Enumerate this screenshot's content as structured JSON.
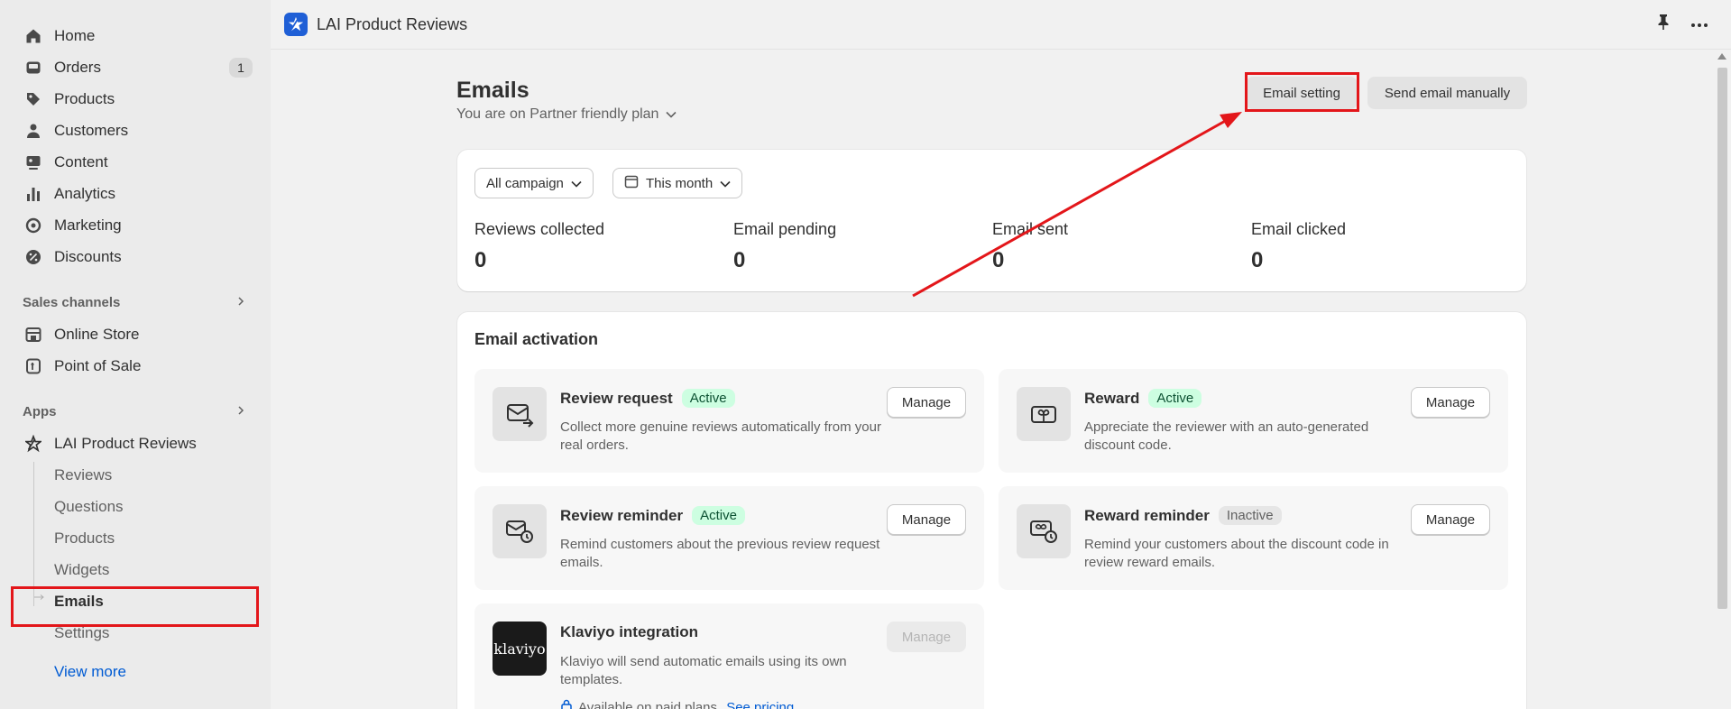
{
  "sidebar": {
    "nav": [
      {
        "label": "Home",
        "icon": "home-icon"
      },
      {
        "label": "Orders",
        "icon": "inbox-icon",
        "badge": "1"
      },
      {
        "label": "Products",
        "icon": "tag-icon"
      },
      {
        "label": "Customers",
        "icon": "person-icon"
      },
      {
        "label": "Content",
        "icon": "content-icon"
      },
      {
        "label": "Analytics",
        "icon": "bar-chart-icon"
      },
      {
        "label": "Marketing",
        "icon": "target-icon"
      },
      {
        "label": "Discounts",
        "icon": "discount-icon"
      }
    ],
    "sales_channels": {
      "title": "Sales channels",
      "items": [
        {
          "label": "Online Store"
        },
        {
          "label": "Point of Sale"
        }
      ]
    },
    "apps": {
      "title": "Apps",
      "app_name": "LAI Product Reviews",
      "sub_items": [
        {
          "label": "Reviews"
        },
        {
          "label": "Questions"
        },
        {
          "label": "Products"
        },
        {
          "label": "Widgets"
        },
        {
          "label": "Emails"
        },
        {
          "label": "Settings"
        }
      ]
    },
    "view_more": "View more"
  },
  "topbar": {
    "title": "LAI Product Reviews"
  },
  "main": {
    "title": "Emails",
    "plan": "You are on Partner friendly plan",
    "email_setting_label": "Email setting",
    "send_manually_label": "Send email manually",
    "filters": {
      "campaign": "All campaign",
      "period": "This month"
    },
    "stats": [
      {
        "label": "Reviews collected",
        "value": "0"
      },
      {
        "label": "Email pending",
        "value": "0"
      },
      {
        "label": "Email sent",
        "value": "0"
      },
      {
        "label": "Email clicked",
        "value": "0"
      }
    ],
    "activation": {
      "title": "Email activation",
      "tiles": [
        {
          "title": "Review request",
          "status": "Active",
          "desc": "Collect more genuine reviews automatically from your real orders.",
          "manage": "Manage"
        },
        {
          "title": "Reward",
          "status": "Active",
          "desc": "Appreciate the reviewer with an auto-generated discount code.",
          "manage": "Manage"
        },
        {
          "title": "Review reminder",
          "status": "Active",
          "desc": "Remind customers about the previous review request emails.",
          "manage": "Manage"
        },
        {
          "title": "Reward reminder",
          "status": "Inactive",
          "desc": "Remind your customers about the discount code in review reward emails.",
          "manage": "Manage"
        },
        {
          "title": "Klaviyo integration",
          "status": "",
          "desc": "Klaviyo will send automatic emails using its own templates.",
          "manage": "Manage",
          "logo_text": "klaviyo",
          "note": "Available on paid plans.",
          "note_link": "See pricing"
        }
      ]
    }
  },
  "colors": {
    "accent": "#005bd3",
    "highlight": "#e3161a",
    "active_bg": "#cdfee1",
    "active_text": "#0c5132"
  }
}
